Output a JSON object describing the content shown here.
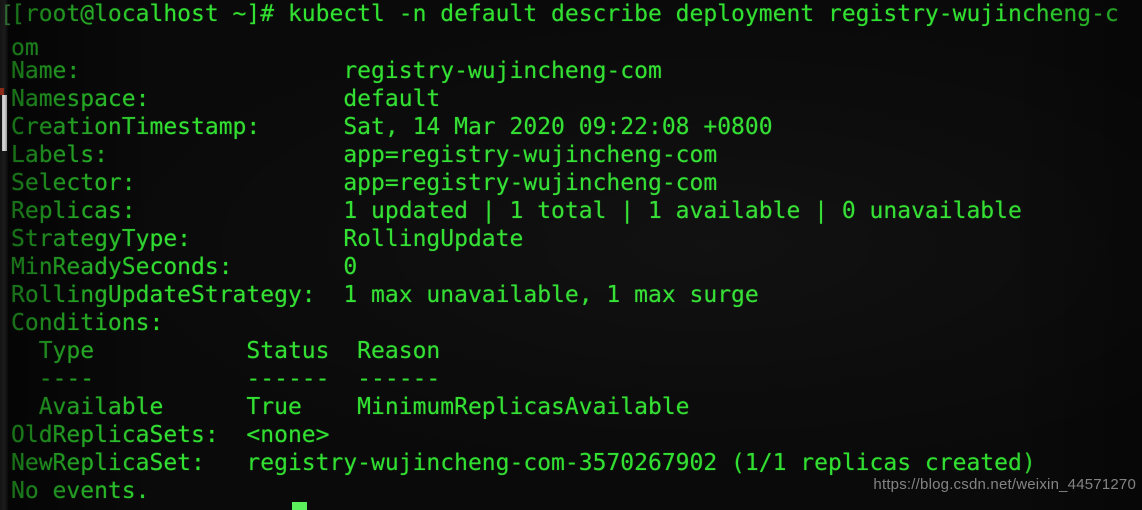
{
  "terminal": {
    "prompt": "[root@localhost ~]# ",
    "command": "kubectl -n default describe deployment registry-wujincheng-com",
    "cursor_column": 20,
    "colors": {
      "foreground": "#32e032",
      "background": "#0a0a0a",
      "cursor": "#5bef5b",
      "watermark": "#8e8e8e"
    },
    "lines": [
      "[root@localhost ~]# kubectl -n default describe deployment registry-wujincheng-c",
      "om",
      "Name:                   registry-wujincheng-com",
      "Namespace:              default",
      "CreationTimestamp:      Sat, 14 Mar 2020 09:22:08 +0800",
      "Labels:                 app=registry-wujincheng-com",
      "Selector:               app=registry-wujincheng-com",
      "Replicas:               1 updated | 1 total | 1 available | 0 unavailable",
      "StrategyType:           RollingUpdate",
      "MinReadySeconds:        0",
      "RollingUpdateStrategy:  1 max unavailable, 1 max surge",
      "Conditions:",
      "  Type           Status  Reason",
      "  ----           ------  ------",
      "  Available      True    MinimumReplicasAvailable",
      "OldReplicaSets:  <none>",
      "NewReplicaSet:   registry-wujincheng-com-3570267902 (1/1 replicas created)",
      "No events."
    ],
    "fields": {
      "name_label": "Name:",
      "name_value": "registry-wujincheng-com",
      "namespace_label": "Namespace:",
      "namespace_value": "default",
      "creation_timestamp_label": "CreationTimestamp:",
      "creation_timestamp_value": "Sat, 14 Mar 2020 09:22:08 +0800",
      "labels_label": "Labels:",
      "labels_value": "app=registry-wujincheng-com",
      "selector_label": "Selector:",
      "selector_value": "app=registry-wujincheng-com",
      "replicas_label": "Replicas:",
      "replicas_value": "1 updated | 1 total | 1 available | 0 unavailable",
      "strategy_type_label": "StrategyType:",
      "strategy_type_value": "RollingUpdate",
      "min_ready_seconds_label": "MinReadySeconds:",
      "min_ready_seconds_value": "0",
      "rolling_update_strategy_label": "RollingUpdateStrategy:",
      "rolling_update_strategy_value": "1 max unavailable, 1 max surge",
      "conditions_label": "Conditions:",
      "old_replicasets_label": "OldReplicaSets:",
      "old_replicasets_value": "<none>",
      "new_replicaset_label": "NewReplicaSet:",
      "new_replicaset_value": "registry-wujincheng-com-3570267902 (1/1 replicas created)",
      "events_value": "No events."
    },
    "conditions_table": {
      "headers": [
        "Type",
        "Status",
        "Reason"
      ],
      "separators": [
        "----",
        "------",
        "------"
      ],
      "rows": [
        [
          "Available",
          "True",
          "MinimumReplicasAvailable"
        ]
      ]
    }
  },
  "watermark": {
    "text": "https://blog.csdn.net/weixin_44571270"
  },
  "ghost": {
    "bracket": "["
  }
}
